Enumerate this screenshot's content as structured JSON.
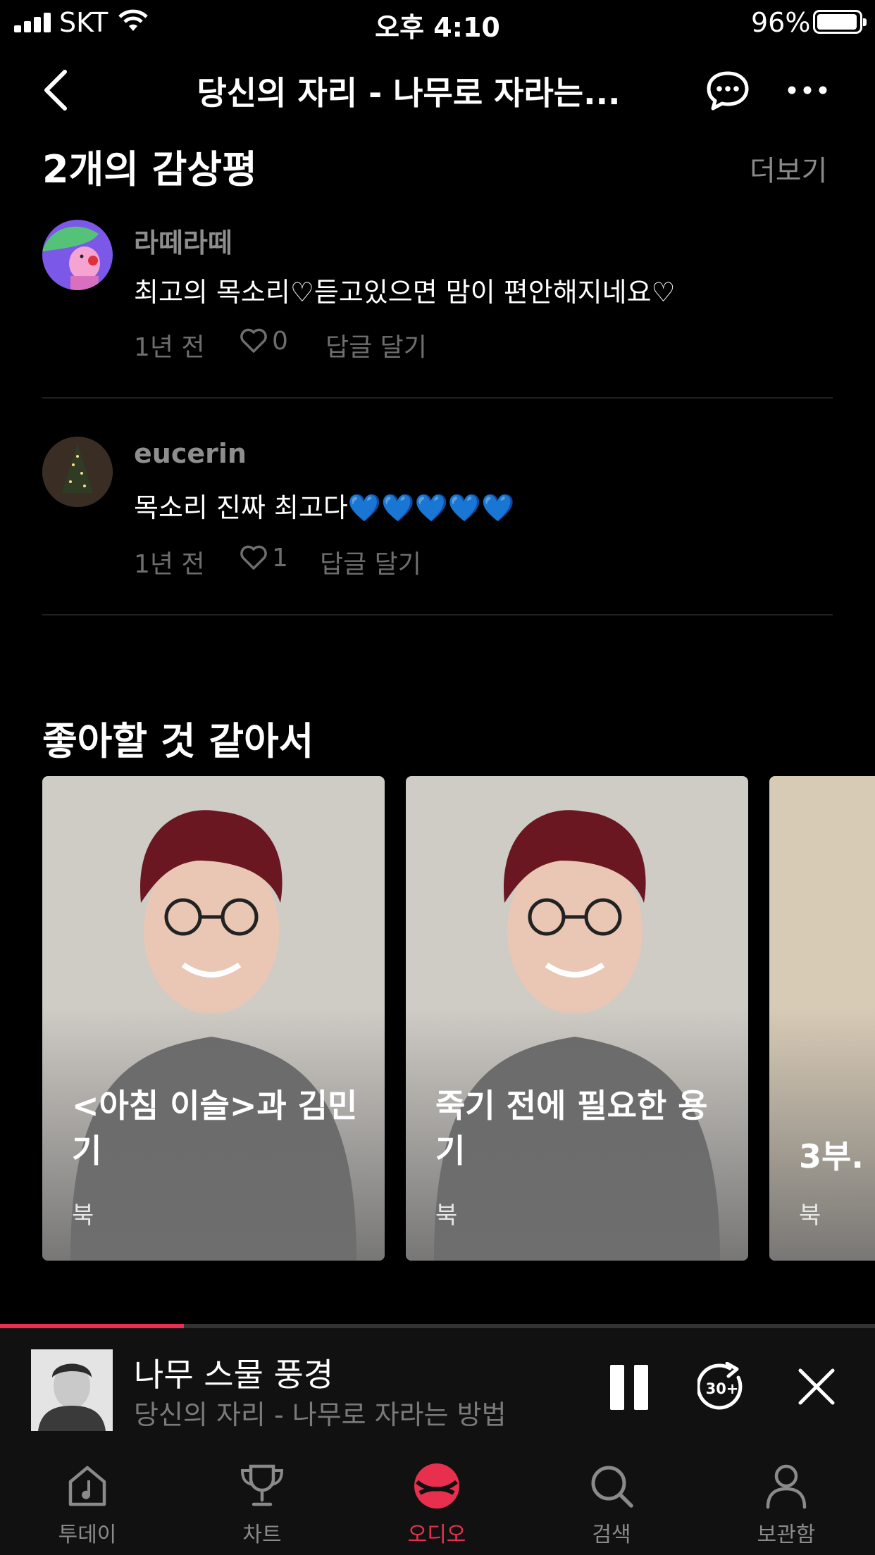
{
  "status_bar": {
    "carrier": "SKT",
    "time": "오후 4:10",
    "battery": "96%"
  },
  "nav": {
    "title": "당신의 자리 - 나무로 자라는..."
  },
  "reviews": {
    "heading": "2개의 감상평",
    "see_all": "더보기",
    "items": [
      {
        "user": "라떼라떼",
        "text": "최고의 목소리♡듣고있으면 맘이 편안해지네요♡",
        "time": "1년 전",
        "likes": "0",
        "reply": "답글 달기"
      },
      {
        "user": "eucerin",
        "text": "목소리 진짜 최고다💙💙💙💙💙",
        "time": "1년 전",
        "likes": "1",
        "reply": "답글 달기"
      }
    ]
  },
  "recommend": {
    "heading": "좋아할 것 같아서",
    "cards": [
      {
        "title": "<아침 이슬>과 김민기",
        "type": "북"
      },
      {
        "title": "죽기 전에 필요한 용기",
        "type": "북"
      },
      {
        "title": "3부.",
        "type": "북"
      }
    ]
  },
  "player": {
    "title": "나무 스물 풍경",
    "subtitle": "당신의 자리 - 나무로 자라는 방법",
    "progress": 0.21,
    "skip_label": "30+"
  },
  "tabs": [
    {
      "label": "투데이",
      "icon": "music-note-house-icon"
    },
    {
      "label": "차트",
      "icon": "trophy-icon"
    },
    {
      "label": "오디오",
      "icon": "audio-logo-icon"
    },
    {
      "label": "검색",
      "icon": "search-icon"
    },
    {
      "label": "보관함",
      "icon": "person-icon"
    }
  ],
  "colors": {
    "accent": "#e8304e",
    "background": "#000000",
    "heart": "#2a5ff0"
  }
}
